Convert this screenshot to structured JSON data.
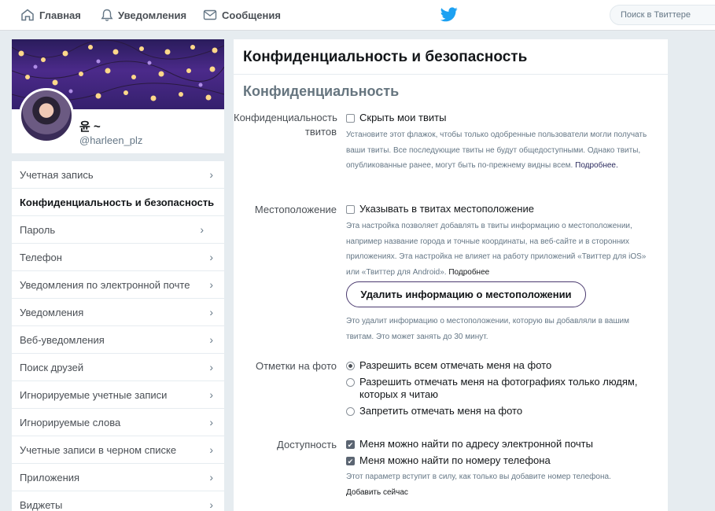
{
  "topbar": {
    "home": "Главная",
    "notifications": "Уведомления",
    "messages": "Сообщения",
    "search_placeholder": "Поиск в Твиттере"
  },
  "profile": {
    "display_name": "윤 ~",
    "handle": "@harleen_plz"
  },
  "menu": {
    "items": [
      {
        "label": "Учетная запись"
      },
      {
        "label": "Конфиденциальность и безопасность",
        "active": true
      },
      {
        "label": "Пароль"
      },
      {
        "label": "Телефон"
      },
      {
        "label": "Уведомления по электронной почте"
      },
      {
        "label": "Уведомления"
      },
      {
        "label": "Веб-уведомления"
      },
      {
        "label": "Поиск друзей"
      },
      {
        "label": "Игнорируемые учетные записи"
      },
      {
        "label": "Игнорируемые слова"
      },
      {
        "label": "Учетные записи в черном списке"
      },
      {
        "label": "Приложения"
      },
      {
        "label": "Виджеты"
      }
    ]
  },
  "main": {
    "title": "Конфиденциальность и безопасность",
    "section": "Конфиденциальность",
    "tweet_privacy": {
      "label": "Конфиденциальность твитов",
      "option": "Скрыть мои твиты",
      "checked": false,
      "help": "Установите этот флажок, чтобы только одобренные пользователи могли получать ваши твиты. Все последующие твиты не будут общедоступными. Однако твиты, опубликованные ранее, могут быть по-прежнему видны всем.",
      "link": "Подробнее."
    },
    "location": {
      "label": "Местоположение",
      "option": "Указывать в твитах местоположение",
      "checked": false,
      "help": "Эта настройка позволяет добавлять в твиты информацию о местоположении, например название города и точные координаты, на веб-сайте и в сторонних приложениях. Эта настройка не влияет на работу приложений «Твиттер для iOS» или «Твиттер для Android».",
      "link": "Подробнее",
      "button": "Удалить информацию о местоположении",
      "button_help": "Это удалит информацию о местоположении, которую вы добавляли в вашим твитам. Это может занять до 30 минут."
    },
    "photo_tagging": {
      "label": "Отметки на фото",
      "options": [
        {
          "label": "Разрешить всем отмечать меня на фото",
          "selected": true
        },
        {
          "label": "Разрешить отмечать меня на фотографиях только людям, которых я читаю",
          "selected": false
        },
        {
          "label": "Запретить отмечать меня на фото",
          "selected": false
        }
      ]
    },
    "discoverability": {
      "label": "Доступность",
      "email_option": "Меня можно найти по адресу электронной почты",
      "phone_option": "Меня можно найти по номеру телефона",
      "email_checked": true,
      "phone_checked": true,
      "help": "Этот параметр вступит в силу, как только вы добавите номер телефона.",
      "link": "Добавить сейчас"
    }
  },
  "icons": {
    "home": "home-icon",
    "notifications": "bell-icon",
    "messages": "envelope-icon",
    "logo": "twitter-bird-icon",
    "chevron": "chevron-right-icon"
  },
  "colors": {
    "brand": "#1da1f2",
    "banner": "#3a2470",
    "button_border": "#4a3a6f"
  }
}
